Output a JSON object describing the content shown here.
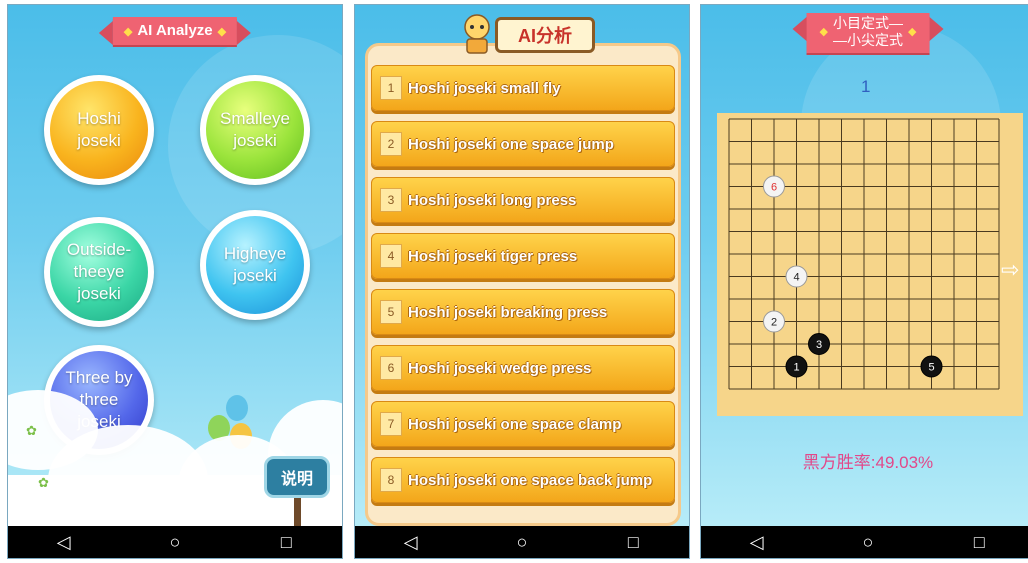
{
  "panel1": {
    "banner": "AI Analyze",
    "buttons": [
      {
        "label": "Hoshi joseki"
      },
      {
        "label": "Smalleye joseki"
      },
      {
        "label": "Outside-theeye joseki"
      },
      {
        "label": "Higheye joseki"
      },
      {
        "label": "Three by three joseki"
      }
    ],
    "sign": "说明"
  },
  "panel2": {
    "header": "AI分析",
    "items": [
      {
        "num": "1",
        "label": "Hoshi joseki small fly"
      },
      {
        "num": "2",
        "label": "Hoshi joseki one space jump"
      },
      {
        "num": "3",
        "label": "Hoshi joseki long press"
      },
      {
        "num": "4",
        "label": "Hoshi joseki tiger press"
      },
      {
        "num": "5",
        "label": "Hoshi joseki breaking press"
      },
      {
        "num": "6",
        "label": "Hoshi joseki wedge press"
      },
      {
        "num": "7",
        "label": "Hoshi joseki one space clamp"
      },
      {
        "num": "8",
        "label": "Hoshi joseki one space back jump"
      }
    ]
  },
  "panel3": {
    "banner_line1": "小目定式—",
    "banner_line2": "—小尖定式",
    "step": "1",
    "winrate": "黑方胜率:49.03%",
    "stones": [
      {
        "n": "1",
        "color": "black",
        "col": 3,
        "row": 11
      },
      {
        "n": "2",
        "color": "white",
        "col": 2,
        "row": 9
      },
      {
        "n": "3",
        "color": "black",
        "col": 4,
        "row": 10
      },
      {
        "n": "4",
        "color": "white",
        "col": 3,
        "row": 7
      },
      {
        "n": "5",
        "color": "black",
        "col": 9,
        "row": 11
      },
      {
        "n": "6",
        "color": "white",
        "col": 2,
        "row": 3
      }
    ]
  },
  "navbar": {
    "back": "◁",
    "home": "○",
    "recents": "□"
  }
}
